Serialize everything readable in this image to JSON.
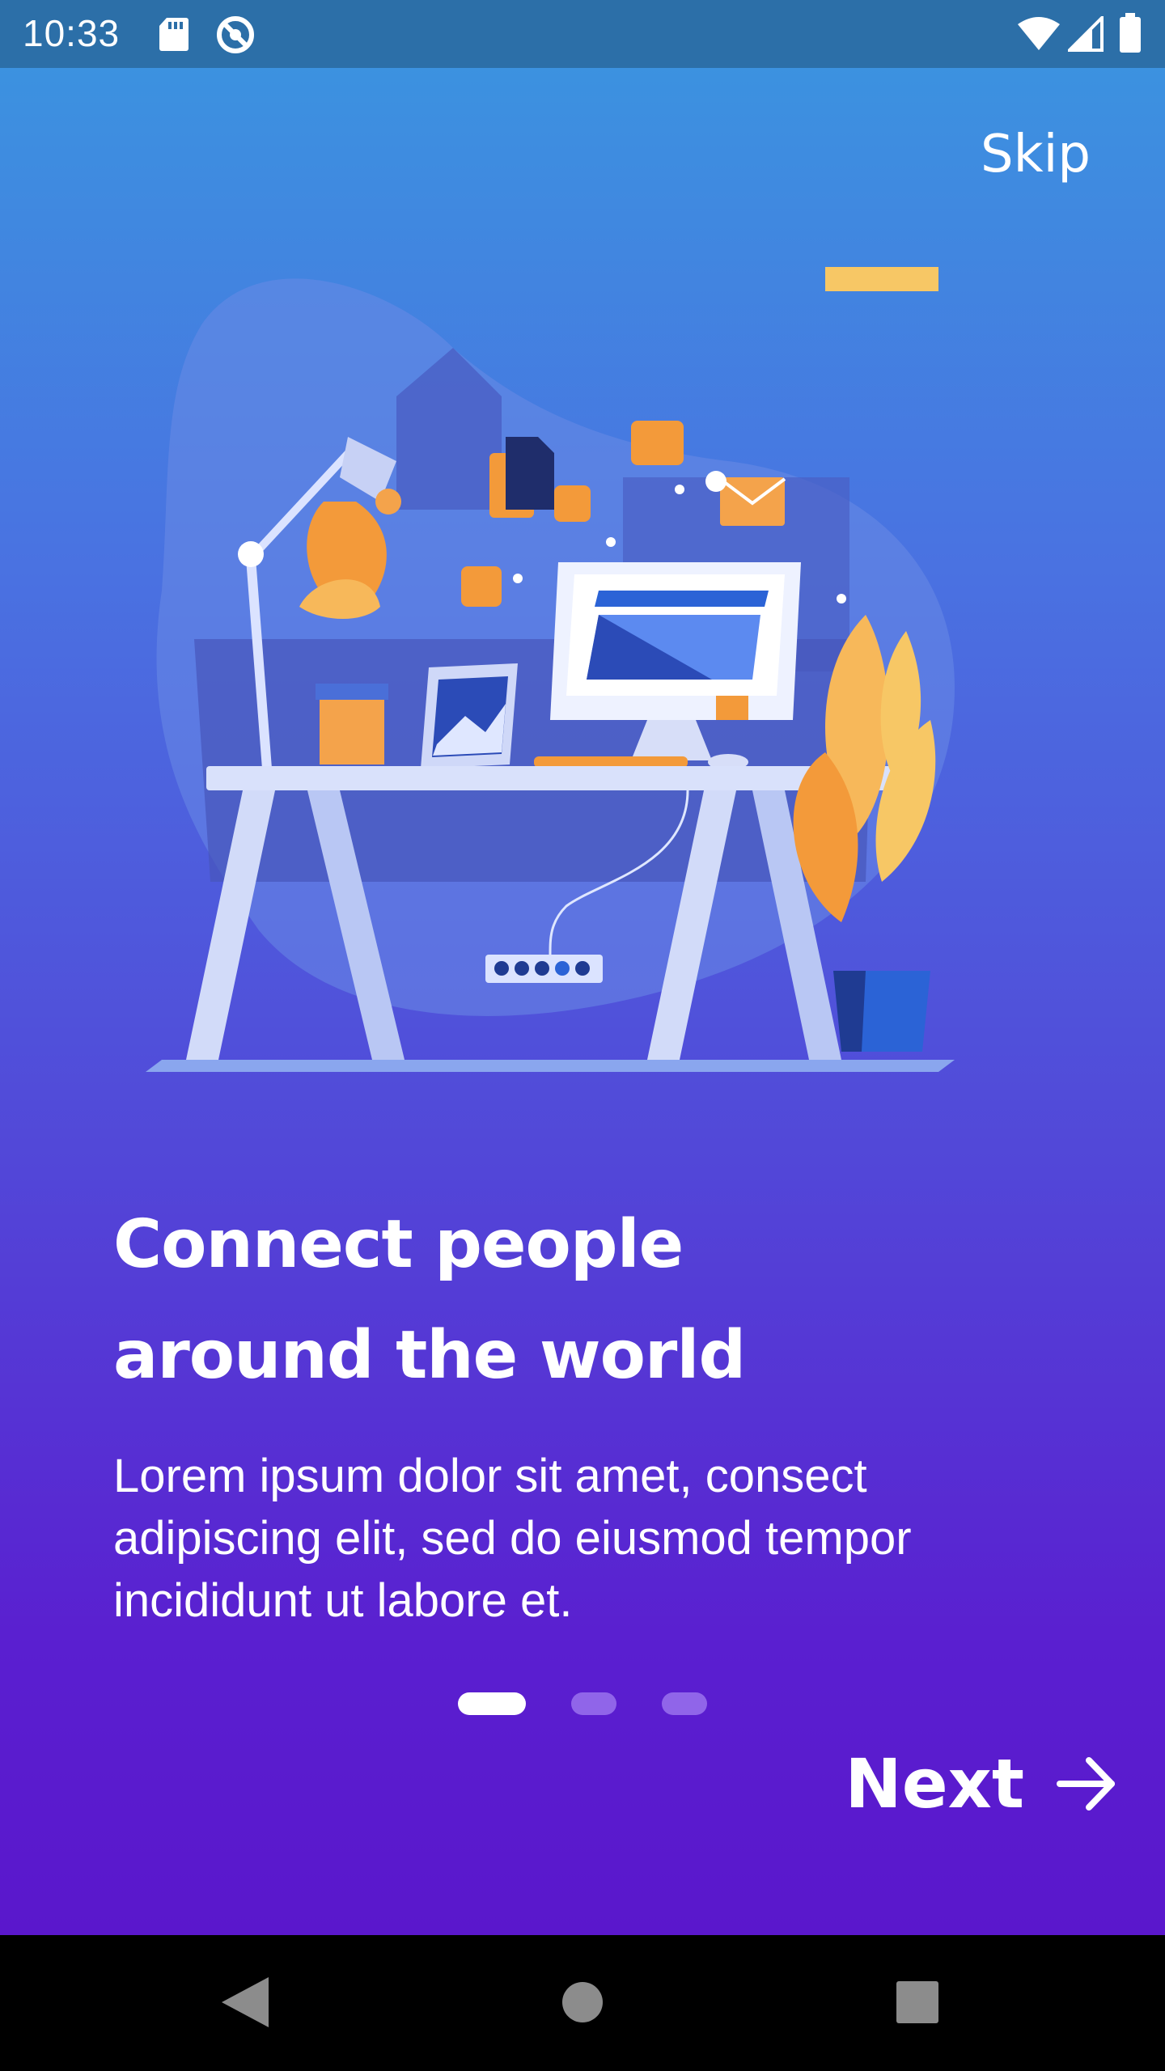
{
  "status_bar": {
    "time": "10:33",
    "icons": [
      "sd-card-icon",
      "sync-icon",
      "wifi-icon",
      "signal-icon",
      "battery-icon"
    ]
  },
  "header": {
    "skip_label": "Skip"
  },
  "illustration": {
    "icon": "desk-workspace-illustration"
  },
  "content": {
    "title_line1": "Connect people",
    "title_line2": "around the world",
    "description_line1": "Lorem ipsum dolor sit amet, consect",
    "description_line2": "adipiscing elit, sed do eiusmod tempor",
    "description_line3": "incididunt ut labore et."
  },
  "pager": {
    "total_pages": 3,
    "current_page": 1
  },
  "footer": {
    "next_label": "Next",
    "next_icon": "arrow-right-icon"
  },
  "nav_bar": {
    "icons": [
      "back-icon",
      "home-icon",
      "recent-apps-icon"
    ]
  },
  "colors": {
    "gradient_top": "#3a96e0",
    "gradient_bottom": "#5a17cc",
    "status_bar": "#2c6fa8",
    "accent_orange": "#f39a3a"
  }
}
